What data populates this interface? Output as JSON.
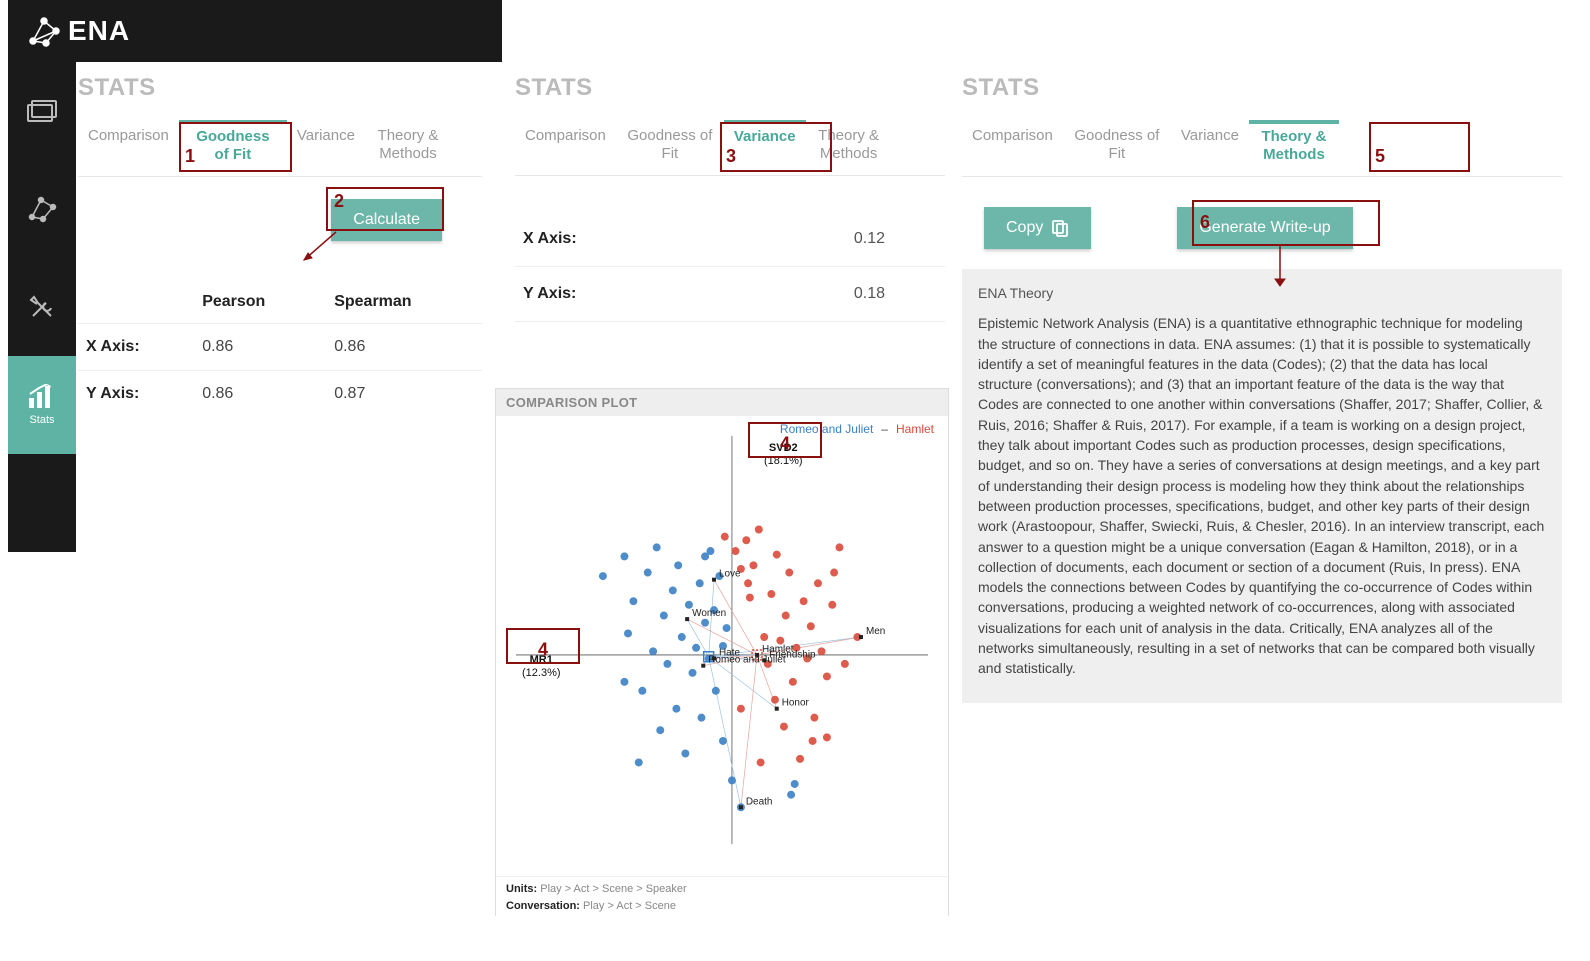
{
  "brand": {
    "name": "ENA"
  },
  "sidebar": {
    "items": [
      {
        "name": "projects",
        "label": ""
      },
      {
        "name": "network",
        "label": ""
      },
      {
        "name": "tools",
        "label": ""
      },
      {
        "name": "stats",
        "label": "Stats",
        "active": true
      }
    ]
  },
  "panel1": {
    "title": "STATS",
    "tabs": [
      "Comparison",
      "Goodness of Fit",
      "Variance",
      "Theory & Methods"
    ],
    "active_tab": 1,
    "calculate_label": "Calculate",
    "columns": [
      "Pearson",
      "Spearman"
    ],
    "rows": [
      {
        "label": "X Axis:",
        "pearson": "0.86",
        "spearman": "0.86"
      },
      {
        "label": "Y Axis:",
        "pearson": "0.86",
        "spearman": "0.87"
      }
    ]
  },
  "panel2": {
    "title": "STATS",
    "tabs": [
      "Comparison",
      "Goodness of Fit",
      "Variance",
      "Theory & Methods"
    ],
    "active_tab": 2,
    "rows": [
      {
        "label": "X Axis:",
        "value": "0.12"
      },
      {
        "label": "Y Axis:",
        "value": "0.18"
      }
    ]
  },
  "plot": {
    "title": "COMPARISON PLOT",
    "legend": [
      "Romeo and Juliet",
      "Hamlet"
    ],
    "axes": {
      "x": {
        "label": "MR1",
        "pct": "(12.3%)"
      },
      "y": {
        "label": "SVD2",
        "pct": "(18.1%)"
      }
    },
    "node_labels": [
      "Love",
      "Women",
      "Men",
      "Hate",
      "Hamlet",
      "Friendship",
      "Romeo and Juliet",
      "Honor",
      "Death"
    ],
    "footer": {
      "k1": "Units:",
      "v1": "Play > Act > Scene > Speaker",
      "k2": "Conversation:",
      "v2": "Play > Act > Scene"
    }
  },
  "panel3": {
    "title": "STATS",
    "tabs": [
      "Comparison",
      "Goodness of Fit",
      "Variance",
      "Theory & Methods"
    ],
    "active_tab": 3,
    "copy_label": "Copy",
    "generate_label": "Generate Write-up",
    "theory_heading": "ENA Theory",
    "theory_body": "Epistemic Network Analysis (ENA) is a quantitative ethnographic technique for modeling the structure of connections in data. ENA assumes: (1) that it is possible to systematically identify a set of meaningful features in the data (Codes); (2) that the data has local structure (conversations); and (3) that an important feature of the data is the way that Codes are connected to one another within conversations (Shaffer, 2017; Shaffer, Collier, & Ruis, 2016; Shaffer & Ruis, 2017). For example, if a team is working on a design project, they talk about important Codes such as production processes, design specifications, budget, and so on. They have a series of conversations at design meetings, and a key part of understanding their design process is modeling how they think about the relationships between production processes, specifications, budget, and other key parts of their design work (Arastoopour, Shaffer, Swiecki, Ruis, & Chesler, 2016). In an interview transcript, each answer to a question might be a unique conversation (Eagan & Hamilton, 2018), or in a collection of documents, each document or section of a document (Ruis, In press). ENA models the connections between Codes by quantifying the co-occurrence of Codes within conversations, producing a weighted network of co-occurrences, along with associated visualizations for each unit of analysis in the data. Critically, ENA analyzes all of the networks simultaneously, resulting in a set of networks that can be compared both visually and statistically."
  },
  "callouts": {
    "1": "1",
    "2": "2",
    "3": "3",
    "4": "4",
    "5": "5",
    "6": "6"
  },
  "chart_data": {
    "type": "scatter",
    "title": "COMPARISON PLOT",
    "xlabel": "MR1 (12.3%)",
    "ylabel": "SVD2 (18.1%)",
    "xlim": [
      -1,
      1
    ],
    "ylim": [
      -1,
      1
    ],
    "series": [
      {
        "name": "Romeo and Juliet",
        "color": "#3b7fc4",
        "values": [
          [
            -0.72,
            0.44
          ],
          [
            -0.6,
            0.55
          ],
          [
            -0.58,
            0.12
          ],
          [
            -0.55,
            0.3
          ],
          [
            -0.5,
            -0.2
          ],
          [
            -0.47,
            0.46
          ],
          [
            -0.44,
            0.02
          ],
          [
            -0.42,
            0.6
          ],
          [
            -0.4,
            -0.42
          ],
          [
            -0.38,
            0.22
          ],
          [
            -0.36,
            -0.05
          ],
          [
            -0.33,
            0.36
          ],
          [
            -0.31,
            -0.3
          ],
          [
            -0.3,
            0.5
          ],
          [
            -0.28,
            0.1
          ],
          [
            -0.26,
            -0.55
          ],
          [
            -0.24,
            0.28
          ],
          [
            -0.22,
            -0.1
          ],
          [
            -0.2,
            0.04
          ],
          [
            -0.18,
            0.4
          ],
          [
            -0.17,
            -0.35
          ],
          [
            -0.15,
            0.18
          ],
          [
            -0.13,
            -0.02
          ],
          [
            -0.12,
            0.58
          ],
          [
            -0.1,
            0.25
          ],
          [
            -0.09,
            -0.2
          ],
          [
            -0.07,
            0.44
          ],
          [
            -0.05,
            -0.48
          ],
          [
            -0.03,
            0.15
          ],
          [
            0.0,
            -0.7
          ],
          [
            0.05,
            -0.85
          ],
          [
            -0.52,
            -0.6
          ],
          [
            -0.6,
            -0.15
          ],
          [
            -0.05,
            0.05
          ],
          [
            -0.15,
            0.55
          ],
          [
            0.33,
            -0.78
          ],
          [
            0.35,
            -0.72
          ]
        ]
      },
      {
        "name": "Hamlet",
        "color": "#d94a3a",
        "values": [
          [
            -0.04,
            0.66
          ],
          [
            0.02,
            0.58
          ],
          [
            0.05,
            0.48
          ],
          [
            0.08,
            0.64
          ],
          [
            0.1,
            0.32
          ],
          [
            0.12,
            0.5
          ],
          [
            0.15,
            0.7
          ],
          [
            0.18,
            0.1
          ],
          [
            0.2,
            -0.05
          ],
          [
            0.22,
            0.34
          ],
          [
            0.24,
            -0.25
          ],
          [
            0.25,
            0.56
          ],
          [
            0.27,
            0.08
          ],
          [
            0.29,
            -0.4
          ],
          [
            0.3,
            0.22
          ],
          [
            0.32,
            0.46
          ],
          [
            0.34,
            -0.15
          ],
          [
            0.36,
            0.04
          ],
          [
            0.38,
            -0.58
          ],
          [
            0.4,
            0.3
          ],
          [
            0.42,
            -0.02
          ],
          [
            0.44,
            0.16
          ],
          [
            0.46,
            -0.35
          ],
          [
            0.48,
            0.4
          ],
          [
            0.5,
            0.02
          ],
          [
            0.53,
            -0.12
          ],
          [
            0.56,
            0.28
          ],
          [
            0.6,
            0.6
          ],
          [
            0.63,
            -0.05
          ],
          [
            0.7,
            0.1
          ],
          [
            0.16,
            -0.6
          ],
          [
            0.05,
            -0.3
          ],
          [
            0.09,
            0.4
          ],
          [
            0.53,
            -0.46
          ],
          [
            0.57,
            0.46
          ],
          [
            0.45,
            -0.48
          ]
        ]
      }
    ],
    "network_nodes": [
      {
        "name": "Love",
        "x": -0.1,
        "y": 0.42
      },
      {
        "name": "Women",
        "x": -0.25,
        "y": 0.2
      },
      {
        "name": "Men",
        "x": 0.72,
        "y": 0.1
      },
      {
        "name": "Hate",
        "x": -0.1,
        "y": -0.02
      },
      {
        "name": "Hamlet",
        "x": 0.14,
        "y": 0.0
      },
      {
        "name": "Friendship",
        "x": 0.18,
        "y": -0.03
      },
      {
        "name": "Romeo and Juliet",
        "x": -0.16,
        "y": -0.06
      },
      {
        "name": "Honor",
        "x": 0.25,
        "y": -0.3
      },
      {
        "name": "Death",
        "x": 0.05,
        "y": -0.85
      }
    ],
    "centroids": {
      "Romeo and Juliet": [
        -0.13,
        -0.01
      ],
      "Hamlet": [
        0.14,
        0.0
      ]
    }
  }
}
